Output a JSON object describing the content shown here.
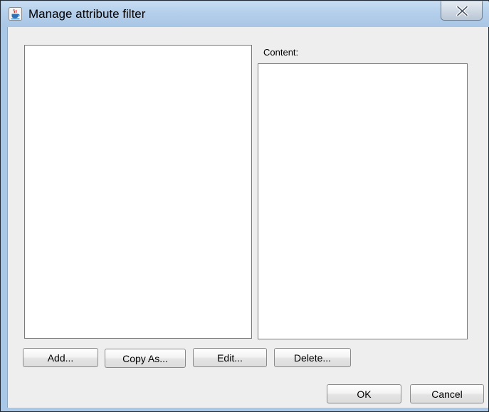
{
  "window": {
    "title": "Manage attribute filter",
    "icon": "java-cup-icon",
    "close_icon": "close-x-icon"
  },
  "panel": {
    "content_label": "Content:"
  },
  "buttons": {
    "add": "Add...",
    "copy_as": "Copy As...",
    "edit": "Edit...",
    "delete": "Delete...",
    "ok": "OK",
    "cancel": "Cancel"
  },
  "colors": {
    "titlebar": "#b4cfeb",
    "panel_background": "#eeeeee",
    "list_background": "#ffffff"
  }
}
